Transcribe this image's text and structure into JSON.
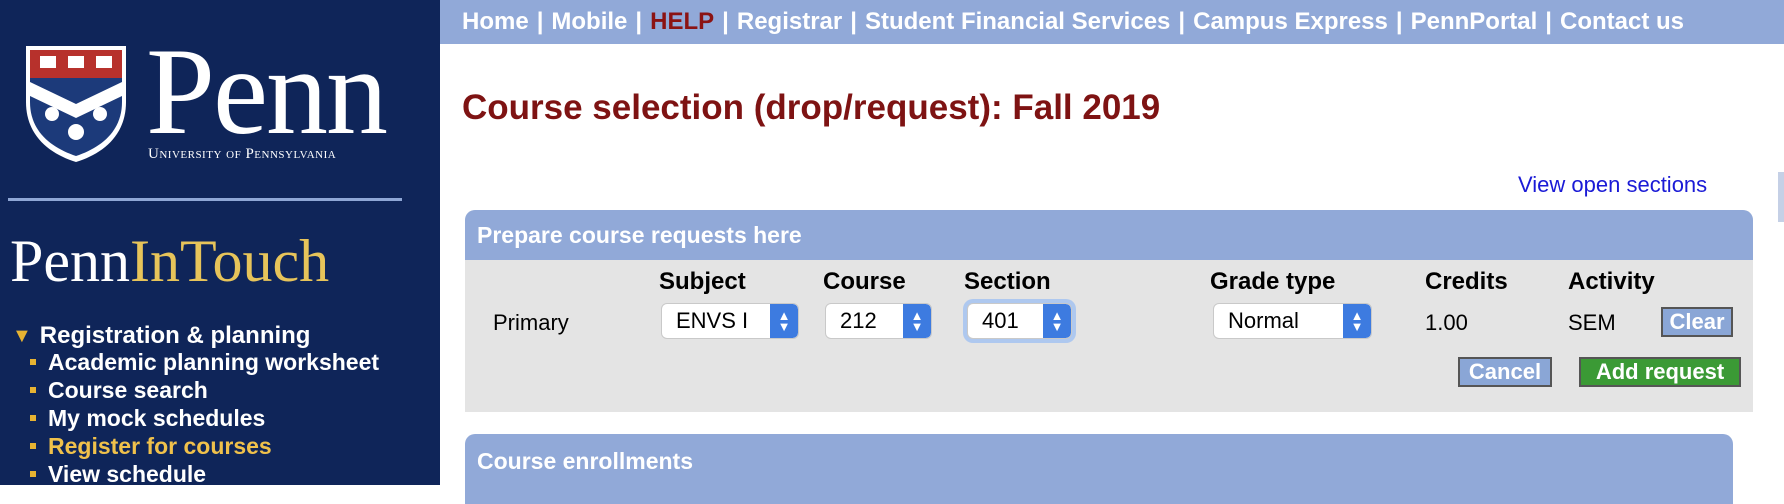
{
  "sidebar": {
    "brand_word": "Penn",
    "brand_sub": "University of Pennsylvania",
    "app_name_a": "Penn",
    "app_name_b": "InTouch",
    "section_label": "Registration & planning",
    "items": [
      {
        "label": "Academic planning worksheet"
      },
      {
        "label": "Course search"
      },
      {
        "label": "My mock schedules"
      },
      {
        "label": "Register for courses",
        "active": true
      },
      {
        "label": "View schedule"
      }
    ]
  },
  "topnav": {
    "links": [
      "Home",
      "Mobile",
      "HELP",
      "Registrar",
      "Student Financial Services",
      "Campus Express",
      "PennPortal",
      "Contact us"
    ]
  },
  "page": {
    "title": "Course selection (drop/request): Fall 2019",
    "view_open_sections": "View open sections"
  },
  "request_panel": {
    "header": "Prepare course requests here",
    "columns": {
      "subject": "Subject",
      "course": "Course",
      "section": "Section",
      "grade_type": "Grade type",
      "credits": "Credits",
      "activity": "Activity"
    },
    "row": {
      "label": "Primary",
      "subject": "ENVS I",
      "course": "212",
      "section": "401",
      "grade_type": "Normal",
      "credits": "1.00",
      "activity": "SEM"
    },
    "buttons": {
      "clear": "Clear",
      "cancel": "Cancel",
      "add": "Add request"
    }
  },
  "enrollments_panel": {
    "header": "Course enrollments"
  },
  "colors": {
    "sidebar_bg": "#0f2559",
    "nav_bar": "#91a9d8",
    "title": "#7e1313",
    "gold": "#e7c45a",
    "add_button": "#3b9a35"
  }
}
